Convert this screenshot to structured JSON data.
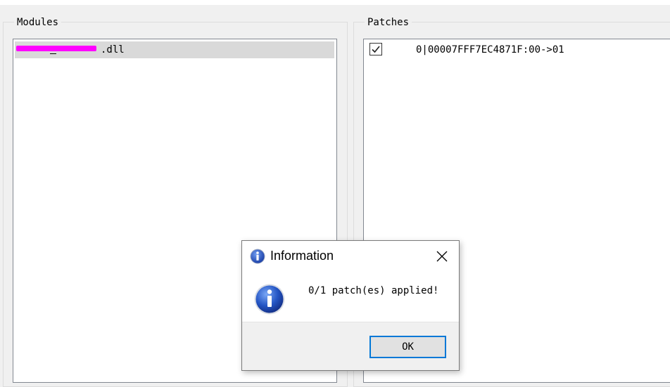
{
  "modules_panel": {
    "label": "Modules",
    "items": [
      {
        "name_suffix": ".dll",
        "selected": true,
        "redacted_prefix": true
      }
    ]
  },
  "patches_panel": {
    "label": "Patches",
    "items": [
      {
        "checked": true,
        "text": "0|00007FFF7EC4871F:00->01"
      }
    ]
  },
  "dialog": {
    "title": "Information",
    "icon": "info-icon",
    "message": "0/1 patch(es) applied!",
    "ok_label": "OK"
  },
  "colors": {
    "redaction": "#ff00ff",
    "selection": "#d9d9d9",
    "focus_border": "#0078d7"
  }
}
